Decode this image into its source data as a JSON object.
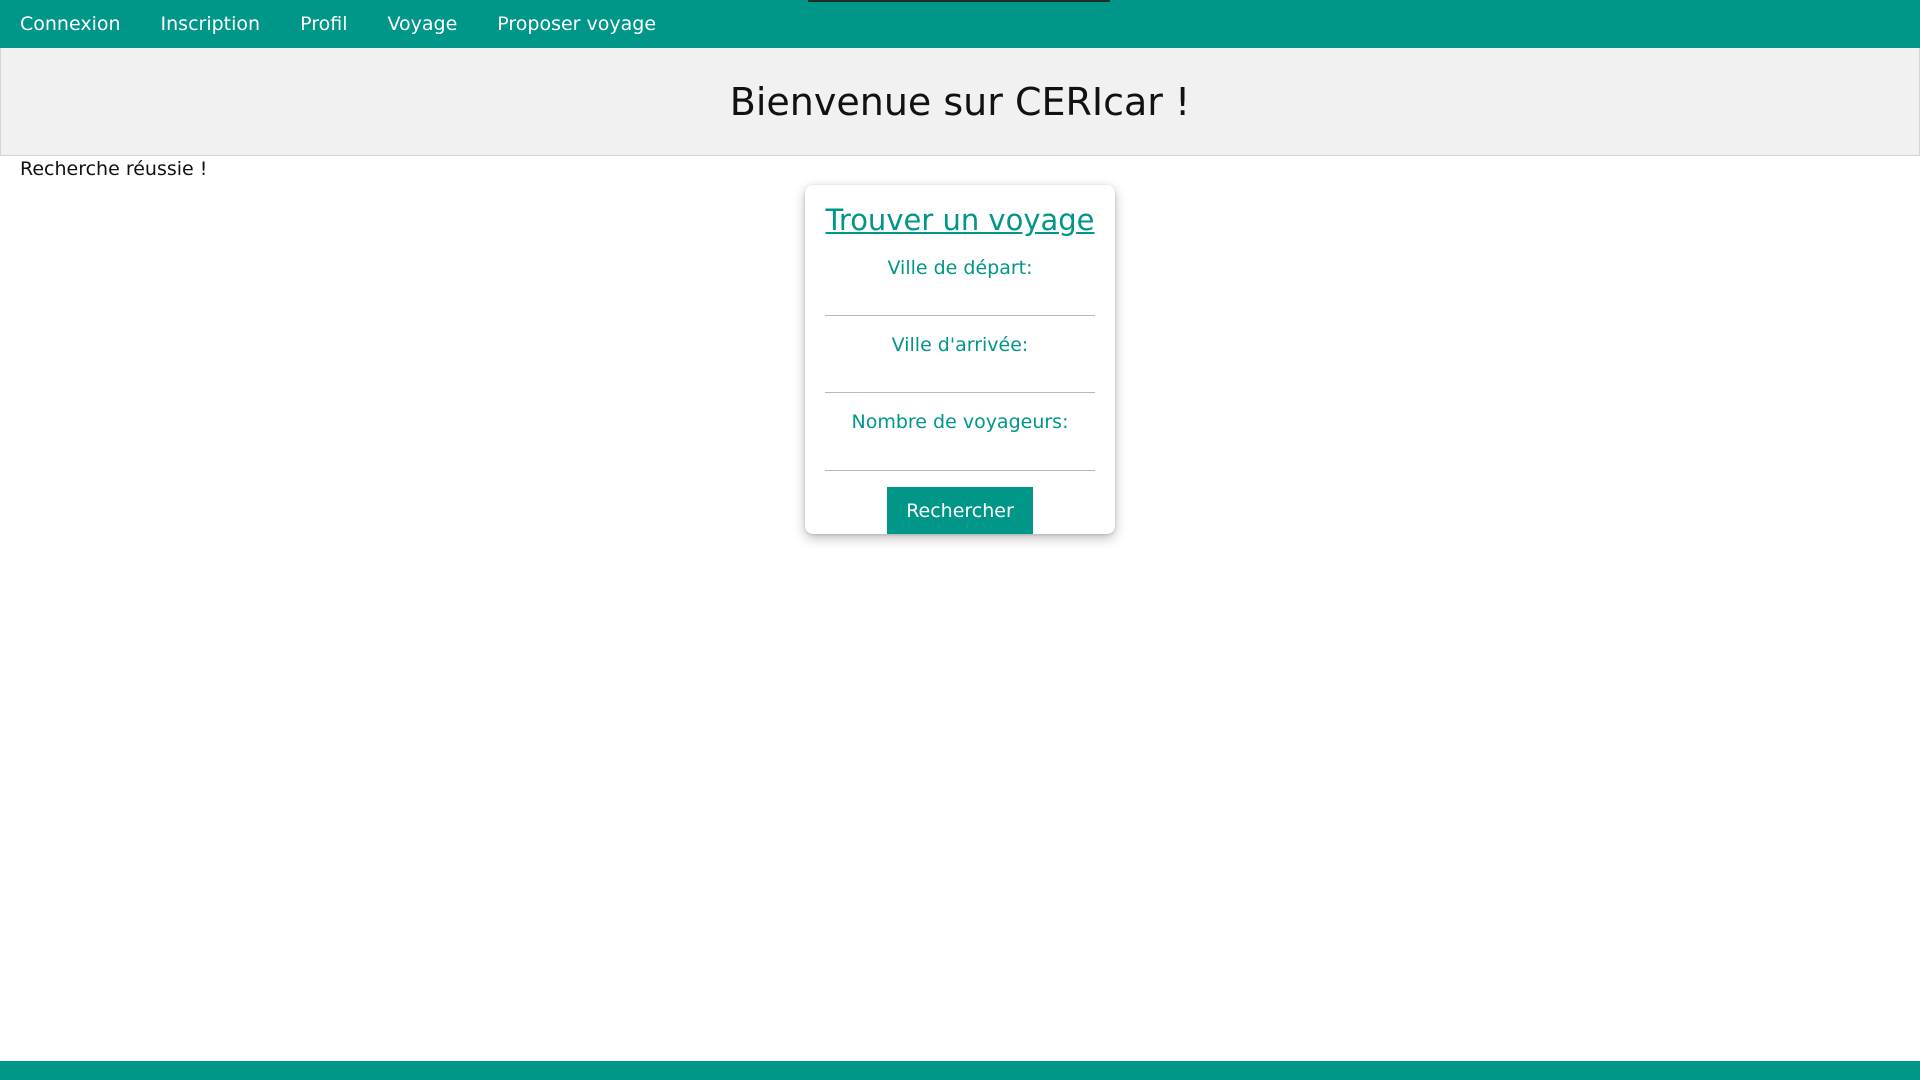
{
  "nav": {
    "items": [
      {
        "label": "Connexion"
      },
      {
        "label": "Inscription"
      },
      {
        "label": "Profil"
      },
      {
        "label": "Voyage"
      },
      {
        "label": "Proposer voyage"
      }
    ]
  },
  "banner": {
    "title": "Bienvenue sur CERIcar !"
  },
  "flash": {
    "message": "Recherche réussie !"
  },
  "search_form": {
    "title": "Trouver un voyage",
    "departure_label": "Ville de départ:",
    "departure_value": "",
    "arrival_label": "Ville d'arrivée:",
    "arrival_value": "",
    "travelers_label": "Nombre de voyageurs:",
    "travelers_value": "",
    "submit_label": "Rechercher"
  },
  "colors": {
    "accent": "#009688",
    "banner_bg": "#f1f1f1",
    "text": "#111111"
  }
}
